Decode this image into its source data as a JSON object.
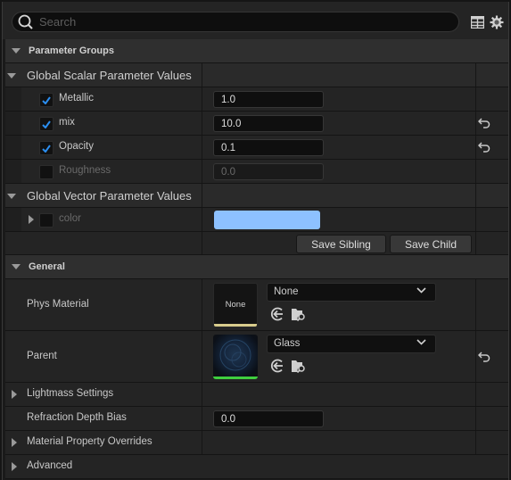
{
  "search": {
    "placeholder": "Search",
    "value": ""
  },
  "toolbar": {
    "table_icon": "table-view-icon",
    "settings_icon": "gear-icon"
  },
  "parameter_groups": {
    "label": "Parameter Groups",
    "scalar_group": {
      "label": "Global Scalar Parameter Values",
      "params": [
        {
          "name": "Metallic",
          "checked": true,
          "value": "1.0",
          "enabled": true,
          "has_reset": false
        },
        {
          "name": "mix",
          "checked": true,
          "value": "10.0",
          "enabled": true,
          "has_reset": true
        },
        {
          "name": "Opacity",
          "checked": true,
          "value": "0.1",
          "enabled": true,
          "has_reset": true
        },
        {
          "name": "Roughness",
          "checked": false,
          "value": "0.0",
          "enabled": false,
          "has_reset": false
        }
      ]
    },
    "vector_group": {
      "label": "Global Vector Parameter Values",
      "params": [
        {
          "name": "color",
          "checked": false,
          "enabled": false,
          "color": "#8dc1ff"
        }
      ]
    },
    "save_sibling_label": "Save Sibling",
    "save_child_label": "Save Child"
  },
  "general": {
    "label": "General",
    "phys_material": {
      "label": "Phys Material",
      "thumb_text": "None",
      "value": "None",
      "bar_color": "#d8cc8c"
    },
    "parent": {
      "label": "Parent",
      "value": "Glass",
      "bar_color": "#3fcf3f"
    },
    "lightmass": {
      "label": "Lightmass Settings"
    },
    "refraction": {
      "label": "Refraction Depth Bias",
      "value": "0.0"
    },
    "overrides": {
      "label": "Material Property Overrides"
    },
    "advanced": {
      "label": "Advanced"
    }
  },
  "colors": {
    "accent_check": "#2b8ef0",
    "background": "#242424"
  }
}
